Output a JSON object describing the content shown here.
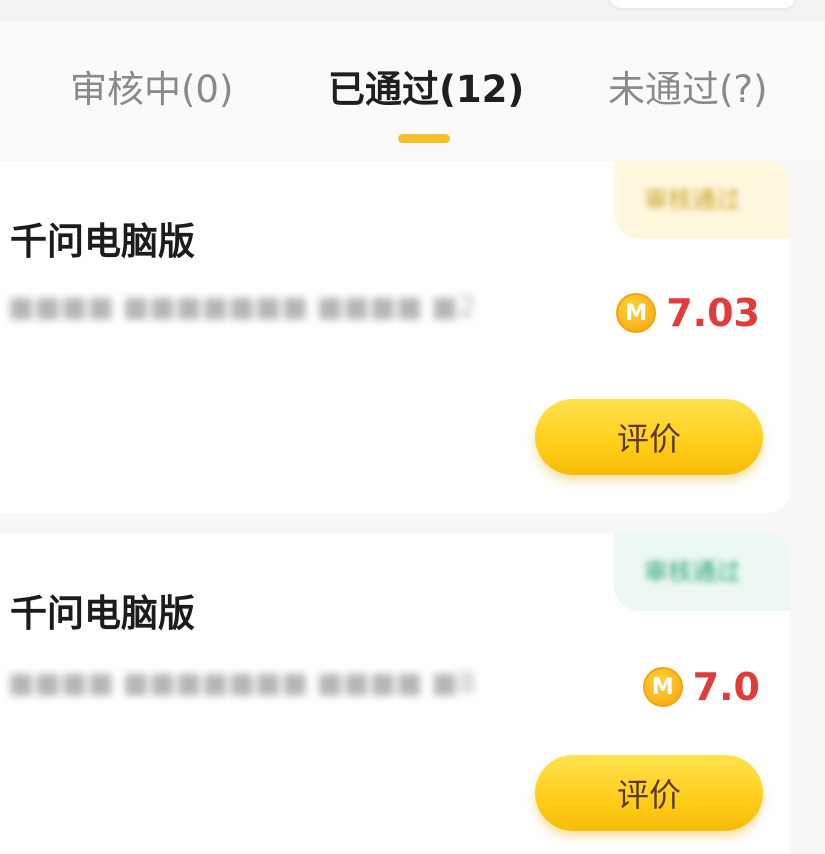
{
  "tabs": [
    {
      "label": "审核中(0)",
      "active": false
    },
    {
      "label": "已通过(12)",
      "active": true
    },
    {
      "label": "未通过(?)",
      "active": false
    }
  ],
  "orders": [
    {
      "status_tag": "审核通过",
      "product_name": "千问电脑版",
      "order_info": "■■■■ ■■■■■■■ ■■■■ ■2",
      "reward_icon_label": "M",
      "reward_amount": "7.03",
      "review_label": "评价"
    },
    {
      "status_tag": "审核通过",
      "product_name": "千问电脑版",
      "order_info": "■■■■ ■■■■■■■ ■■■■ ■8",
      "reward_icon_label": "M",
      "reward_amount": "7.0",
      "review_label": "评价"
    }
  ],
  "colors": {
    "accent_yellow": "#f6c02c",
    "reward_red": "#e23b3b",
    "button_yellow": "#ffcd19"
  }
}
